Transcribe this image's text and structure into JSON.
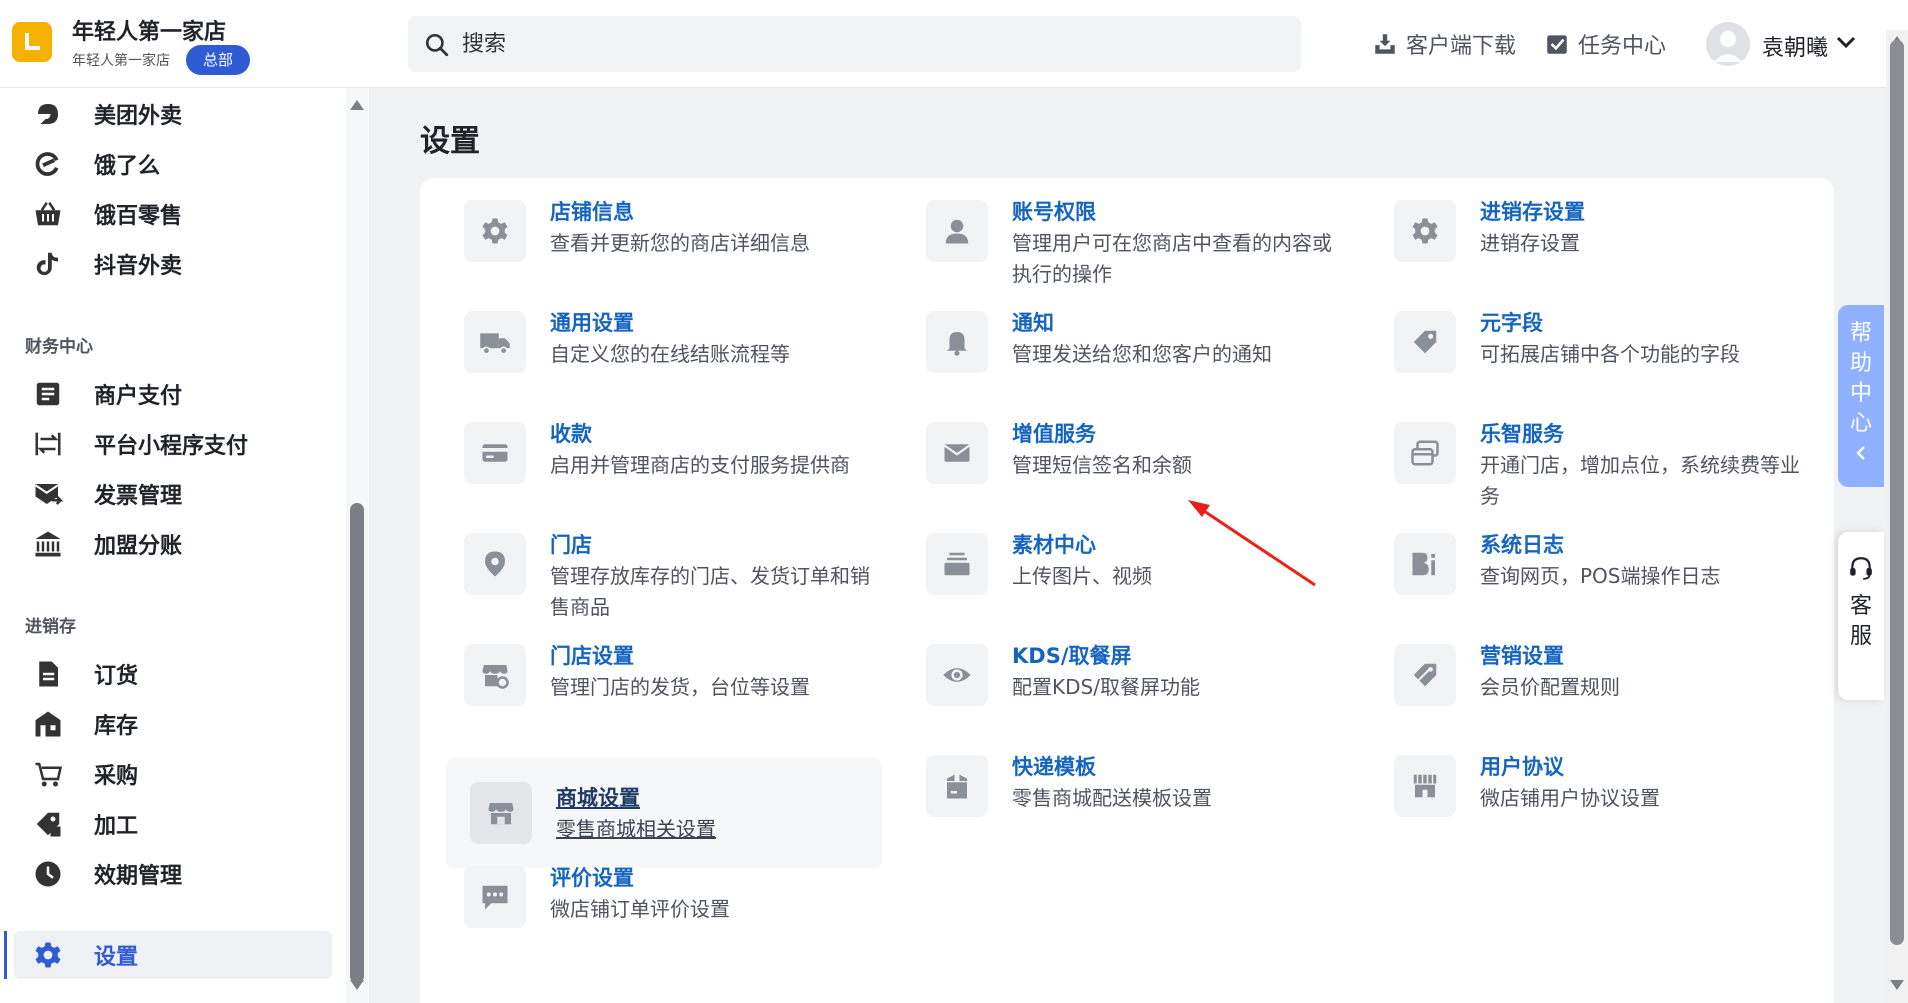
{
  "header": {
    "shop_name": "年轻人第一家店",
    "shop_sub": "年轻人第一家店",
    "hq_badge": "总部",
    "search_placeholder": "搜索",
    "download_label": "客户端下载",
    "task_center_label": "任务中心",
    "username": "袁朝曦"
  },
  "sidebar": {
    "items_top": [
      {
        "label": "美团外卖",
        "icon": "meituan-icon"
      },
      {
        "label": "饿了么",
        "icon": "eleme-icon"
      },
      {
        "label": "饿百零售",
        "icon": "basket-icon"
      },
      {
        "label": "抖音外卖",
        "icon": "tiktok-icon"
      }
    ],
    "group_finance": "财务中心",
    "items_finance": [
      {
        "label": "商户支付",
        "icon": "document-list-icon"
      },
      {
        "label": "平台小程序支付",
        "icon": "transfer-icon"
      },
      {
        "label": "发票管理",
        "icon": "invoice-mail-icon"
      },
      {
        "label": "加盟分账",
        "icon": "bank-icon"
      }
    ],
    "group_inventory": "进销存",
    "items_inventory": [
      {
        "label": "订货",
        "icon": "order-doc-icon"
      },
      {
        "label": "库存",
        "icon": "warehouse-icon"
      },
      {
        "label": "采购",
        "icon": "purchase-icon"
      },
      {
        "label": "加工",
        "icon": "process-icon"
      },
      {
        "label": "效期管理",
        "icon": "clock-icon"
      }
    ],
    "active_item": {
      "label": "设置",
      "icon": "gear-icon"
    }
  },
  "main": {
    "title": "设置",
    "tiles": [
      {
        "title": "店铺信息",
        "desc": "查看并更新您的商店详细信息",
        "icon": "gear-icon"
      },
      {
        "title": "账号权限",
        "desc": "管理用户可在您商店中查看的内容或执行的操作",
        "icon": "user-icon"
      },
      {
        "title": "进销存设置",
        "desc": "进销存设置",
        "icon": "gear-icon"
      },
      {
        "title": "通用设置",
        "desc": "自定义您的在线结账流程等",
        "icon": "truck-icon"
      },
      {
        "title": "通知",
        "desc": "管理发送给您和您客户的通知",
        "icon": "bell-icon"
      },
      {
        "title": "元字段",
        "desc": "可拓展店铺中各个功能的字段",
        "icon": "tag-icon"
      },
      {
        "title": "收款",
        "desc": "启用并管理商店的支付服务提供商",
        "icon": "credit-card-icon"
      },
      {
        "title": "增值服务",
        "desc": "管理短信签名和余额",
        "icon": "mail-icon"
      },
      {
        "title": "乐智服务",
        "desc": "开通门店，增加点位，系统续费等业务",
        "icon": "cards-icon"
      },
      {
        "title": "门店",
        "desc": "管理存放库存的门店、发货订单和销售商品",
        "icon": "location-pin-icon"
      },
      {
        "title": "素材中心",
        "desc": "上传图片、视频",
        "icon": "stack-icon"
      },
      {
        "title": "系统日志",
        "desc": "查询网页，POS端操作日志",
        "icon": "log-icon"
      },
      {
        "title": "门店设置",
        "desc": "管理门店的发货，台位等设置",
        "icon": "store-settings-icon"
      },
      {
        "title": "KDS/取餐屏",
        "desc": "配置KDS/取餐屏功能",
        "icon": "eye-icon"
      },
      {
        "title": "营销设置",
        "desc": "会员价配置规则",
        "icon": "price-tag-icon"
      },
      {
        "title": "商城设置",
        "desc": "零售商城相关设置",
        "icon": "shop-icon"
      },
      {
        "title": "快递模板",
        "desc": "零售商城配送模板设置",
        "icon": "package-icon"
      },
      {
        "title": "用户协议",
        "desc": "微店铺用户协议设置",
        "icon": "storefront-icon"
      },
      {
        "title": "评价设置",
        "desc": "微店铺订单评价设置",
        "icon": "chat-icon"
      }
    ]
  },
  "floaters": {
    "help_center": "帮助中心",
    "customer_service": "客服"
  },
  "colors": {
    "accent": "#2f5bd3",
    "link": "#1565c0",
    "logo": "#f6b100"
  }
}
